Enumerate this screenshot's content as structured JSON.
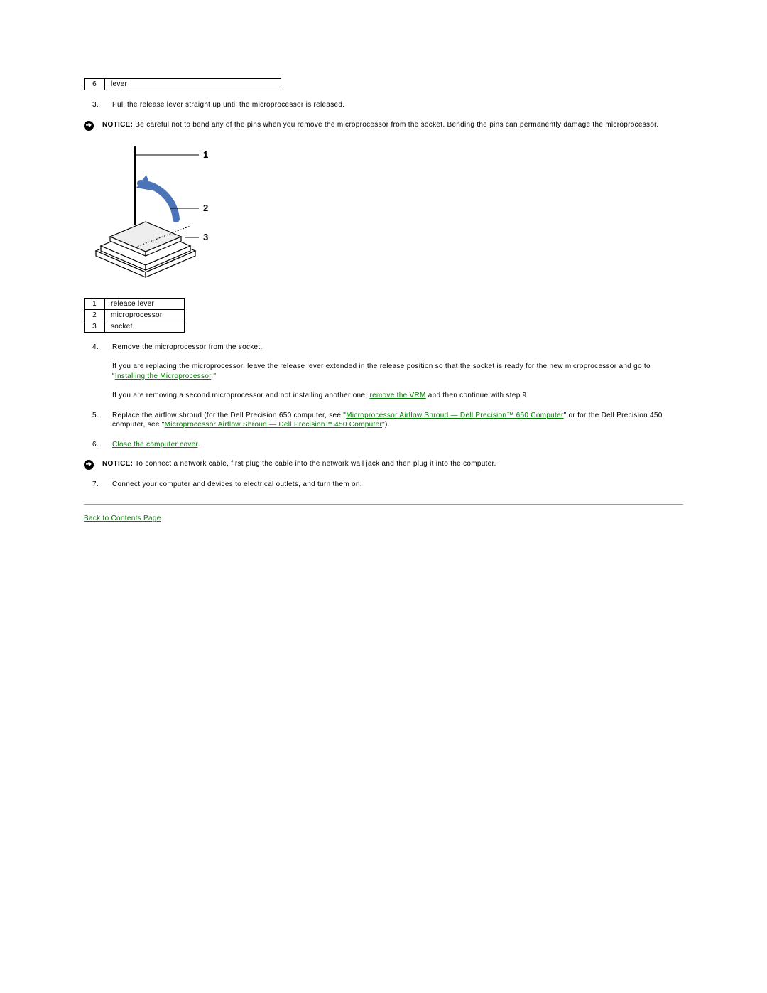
{
  "top_table": {
    "rows": [
      {
        "num": "6",
        "label": "lever"
      }
    ]
  },
  "steps": {
    "s3": {
      "num": "3.",
      "text": "Pull the release lever straight up until the microprocessor is released."
    },
    "s4": {
      "num": "4.",
      "text": "Remove the microprocessor from the socket.",
      "p1_a": "If you are replacing the microprocessor, leave the release lever extended in the release position so that the socket is ready for the new microprocessor and go to \"",
      "p1_link": "Installing the Microprocessor",
      "p1_b": ".\"",
      "p2_a": "If you are removing a second microprocessor and not installing another one, ",
      "p2_link": "remove the VRM",
      "p2_b": " and then continue with step 9."
    },
    "s5": {
      "num": "5.",
      "a": "Replace the airflow shroud (for the Dell Precision 650 computer, see \"",
      "link1": "Microprocessor Airflow Shroud — Dell Precision™ 650 Computer",
      "b": "\" or for the Dell Precision 450 computer, see \"",
      "link2": "Microprocessor Airflow Shroud — Dell Precision™ 450 Computer",
      "c": "\")."
    },
    "s6": {
      "num": "6.",
      "link": "Close the computer cover",
      "tail": "."
    },
    "s7": {
      "num": "7.",
      "text": "Connect your computer and devices to electrical outlets, and turn them on."
    }
  },
  "notices": {
    "n1": {
      "label": "NOTICE:",
      "text": " Be careful not to bend any of the pins when you remove the microprocessor from the socket. Bending the pins can permanently damage the microprocessor."
    },
    "n2": {
      "label": "NOTICE:",
      "text": " To connect a network cable, first plug the cable into the network wall jack and then plug it into the computer."
    }
  },
  "diagram_labels": {
    "l1": "1",
    "l2": "2",
    "l3": "3"
  },
  "mid_table": {
    "rows": [
      {
        "num": "1",
        "label": "release lever"
      },
      {
        "num": "2",
        "label": "microprocessor"
      },
      {
        "num": "3",
        "label": "socket"
      }
    ]
  },
  "back_link": "Back to Contents Page"
}
